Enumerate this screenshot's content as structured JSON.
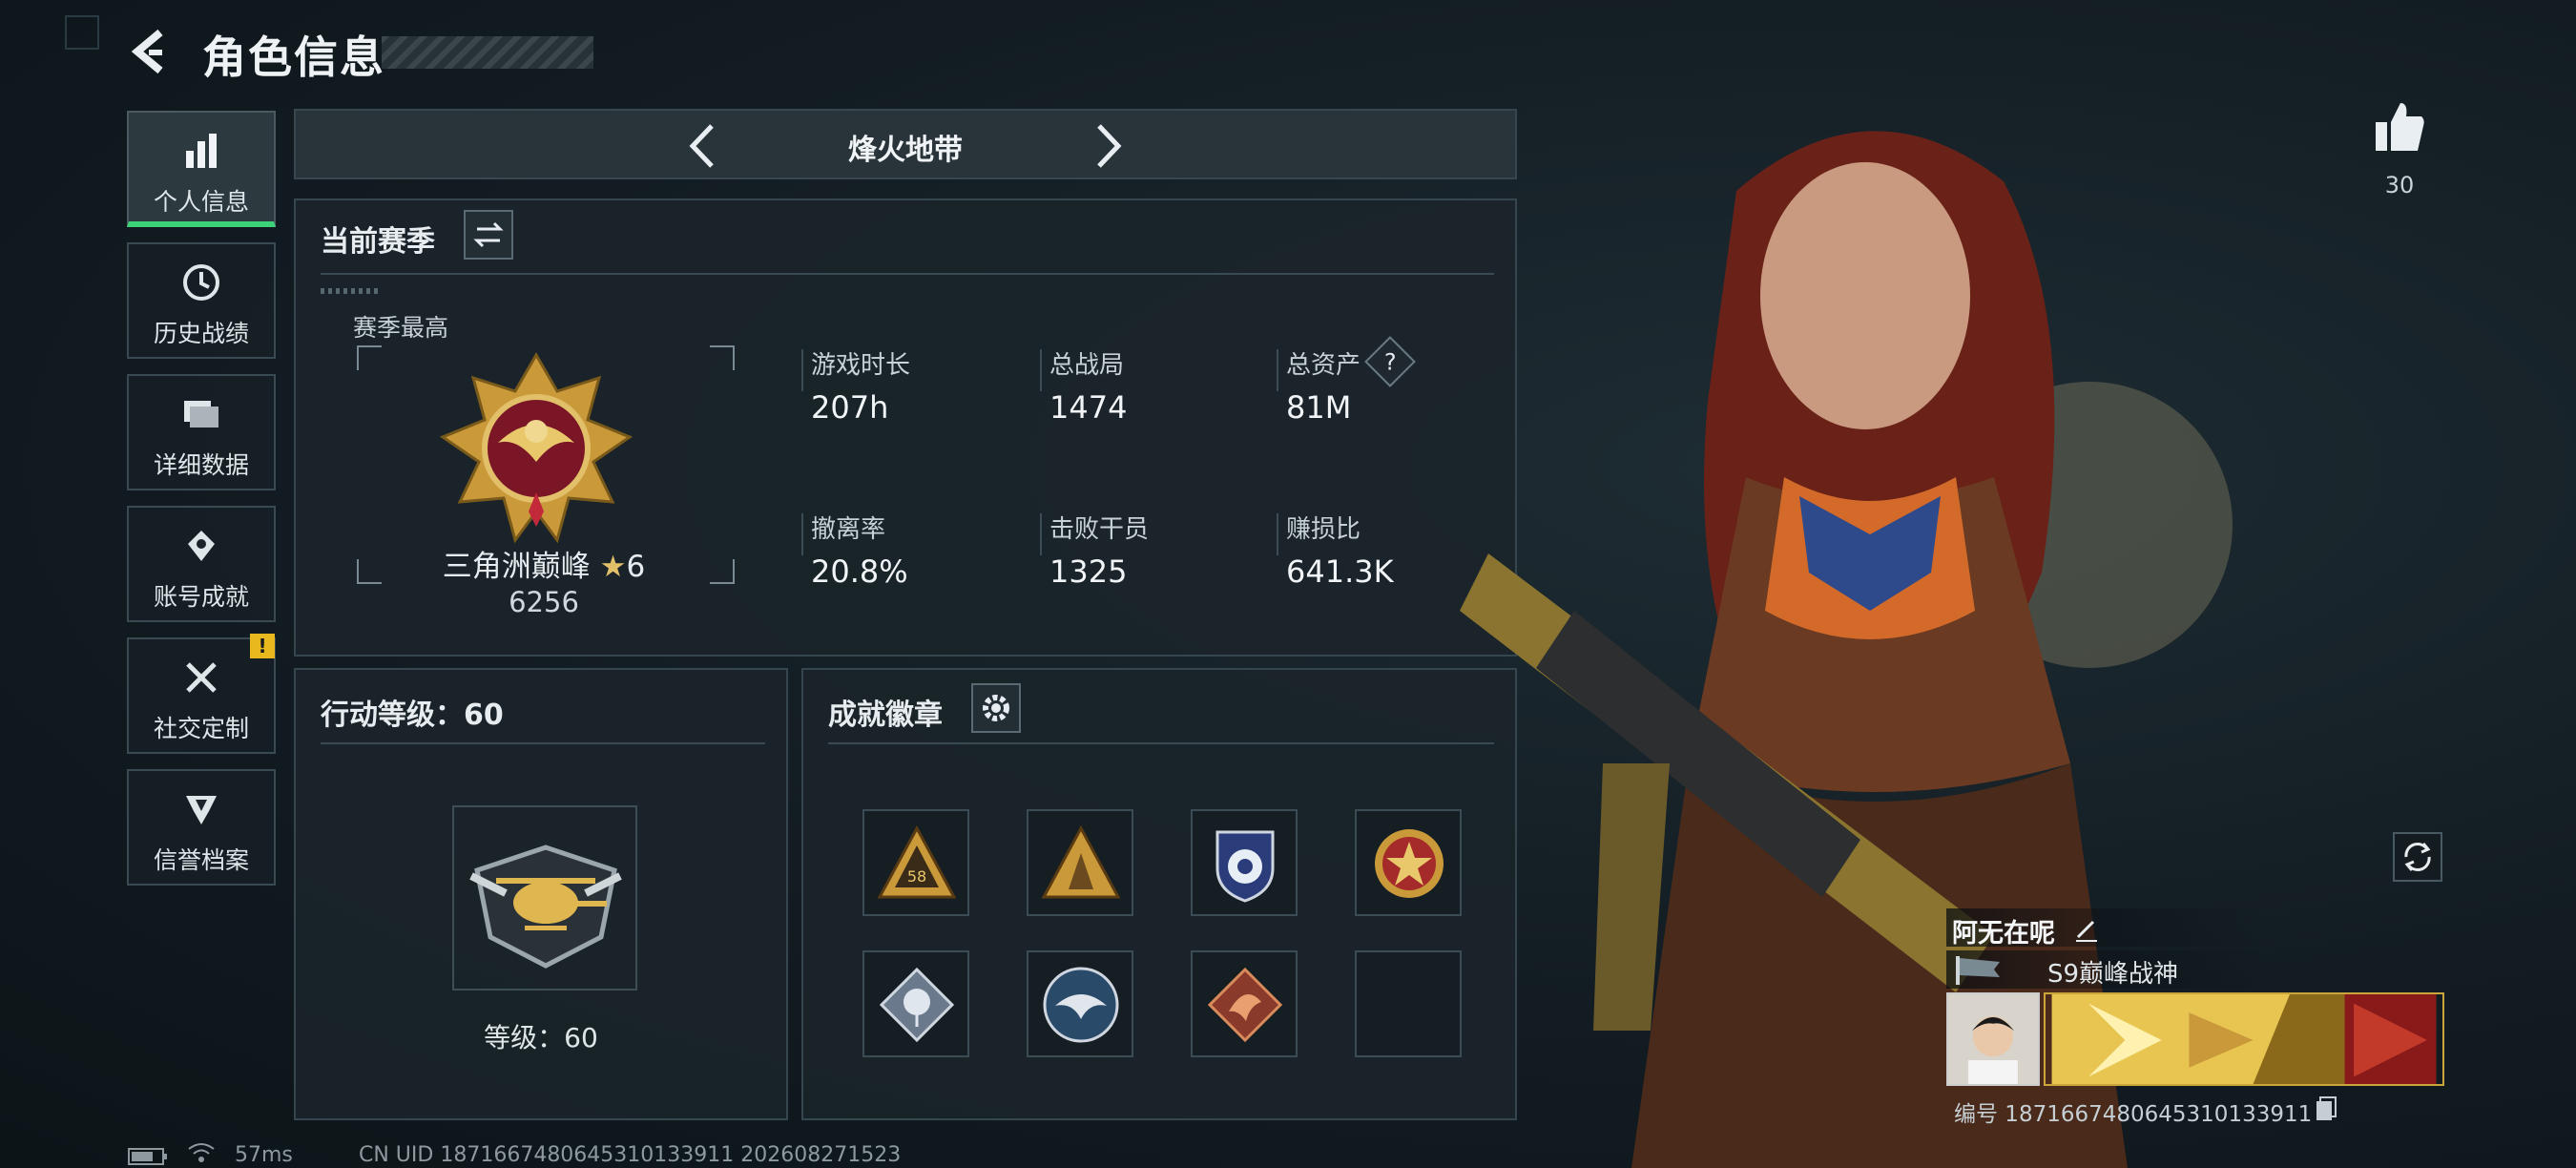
{
  "header": {
    "title": "角色信息"
  },
  "sidebar": {
    "items": [
      {
        "label": "个人信息",
        "icon": "bar-chart-icon",
        "active": true
      },
      {
        "label": "历史战绩",
        "icon": "clock-icon"
      },
      {
        "label": "详细数据",
        "icon": "folder-icon"
      },
      {
        "label": "账号成就",
        "icon": "achievement-icon"
      },
      {
        "label": "社交定制",
        "icon": "tools-icon"
      },
      {
        "label": "信誉档案",
        "icon": "shield-badge-icon"
      }
    ],
    "warning_badge": "!"
  },
  "mode": {
    "title": "烽火地带"
  },
  "season": {
    "label": "当前赛季",
    "best_label": "赛季最高",
    "rank_name": "三角洲巅峰",
    "rank_stars": "6",
    "rank_score": "6256",
    "stats": [
      {
        "label": "游戏时长",
        "value": "207h"
      },
      {
        "label": "总战局",
        "value": "1474"
      },
      {
        "label": "总资产",
        "value": "81M"
      },
      {
        "label": "撤离率",
        "value": "20.8%"
      },
      {
        "label": "击败干员",
        "value": "1325"
      },
      {
        "label": "赚损比",
        "value": "641.3K"
      }
    ],
    "help": "?"
  },
  "level": {
    "title": "行动等级：60",
    "text": "等级：60"
  },
  "badges": {
    "title": "成就徽章",
    "slot_count": 8,
    "badge_58": "58"
  },
  "profile": {
    "likes": "30",
    "name": "阿无在呢",
    "title": "S9巅峰战神",
    "id": "编号 1871667480645310133911"
  },
  "status": {
    "ping": "57ms",
    "uid": "CN UID 1871667480645310133911 202608271523"
  },
  "colors": {
    "accent_green": "#3cd27a",
    "warning_yellow": "#e9b81f",
    "gold": "#c9a53a"
  }
}
